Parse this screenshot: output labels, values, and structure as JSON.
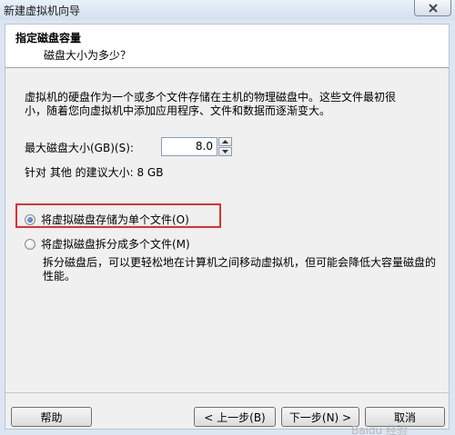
{
  "window": {
    "title": "新建虚拟机向导"
  },
  "header": {
    "title": "指定磁盘容量",
    "subtitle": "磁盘大小为多少？"
  },
  "description": [
    "虚拟机的硬盘作为一个或多个文件存储在主机的物理磁盘中。这些文件最初很",
    "小，随着您向虚拟机中添加应用程序、文件和数据而逐渐变大。"
  ],
  "disk_size": {
    "label": "最大磁盘大小(GB)(S):",
    "value": "8.0",
    "recommended": "针对 其他 的建议大小: 8 GB"
  },
  "storage_options": [
    {
      "label": "将虚拟磁盘存储为单个文件(O)",
      "selected": true
    },
    {
      "label": "将虚拟磁盘拆分成多个文件(M)",
      "selected": false
    }
  ],
  "split_description": [
    "拆分磁盘后，可以更轻松地在计算机之间移动虚拟机，但可能会降低大容量磁盘的",
    "性能。"
  ],
  "buttons": {
    "help": "帮助",
    "back": "< 上一步(B)",
    "next": "下一步(N) >",
    "cancel": "取消"
  },
  "watermark": "Baidu 经验",
  "colors": {
    "highlight_border": "#e03030",
    "radio_dot": "#1a5ca8",
    "header_bg": "#ffffff"
  }
}
